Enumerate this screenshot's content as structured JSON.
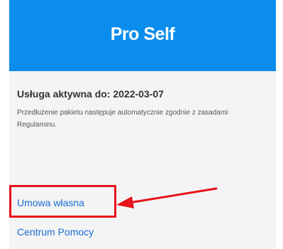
{
  "header": {
    "title": "Pro Self"
  },
  "service": {
    "status_label": "Usługa aktywna do: 2022-03-07",
    "renewal_note": "Przedłużenie pakietu następuje automatycznie zgodnie z zasadami Regulaminu."
  },
  "links": {
    "own_contract": "Umowa własna",
    "help_center": "Centrum Pomocy"
  },
  "colors": {
    "header_bg": "#0a8ded",
    "link": "#1a6dd4",
    "annotation": "#e8131b"
  }
}
